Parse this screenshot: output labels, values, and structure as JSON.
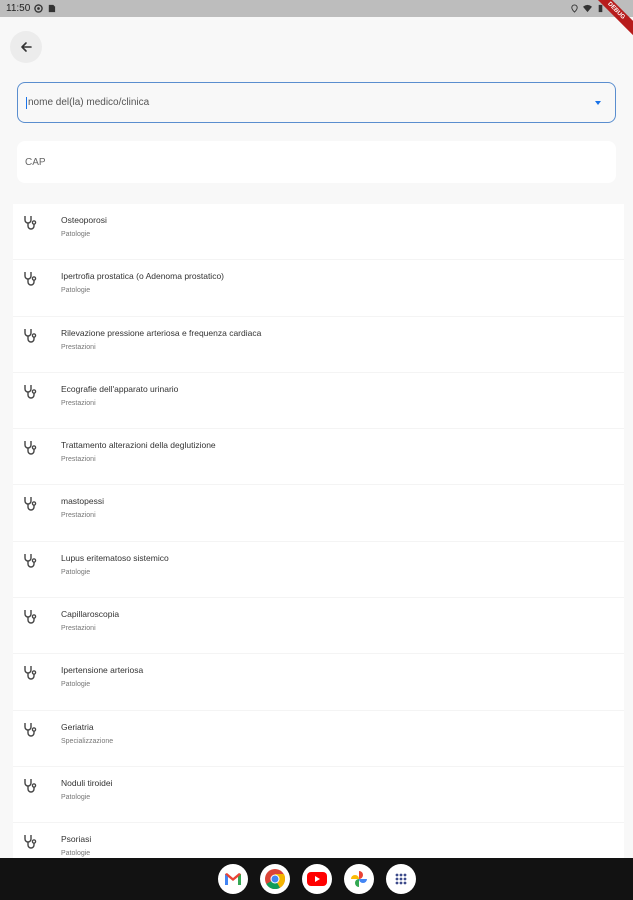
{
  "status_bar": {
    "time": "11:50"
  },
  "debug_banner": "DEBUG",
  "search": {
    "name_placeholder": "nome del(la) medico/clinica",
    "cap_placeholder": "CAP"
  },
  "results": [
    {
      "title": "Osteoporosi",
      "category": "Patologie"
    },
    {
      "title": "Ipertrofia prostatica (o Adenoma prostatico)",
      "category": "Patologie"
    },
    {
      "title": "Rilevazione pressione arteriosa e frequenza cardiaca",
      "category": "Prestazioni"
    },
    {
      "title": "Ecografie dell'apparato urinario",
      "category": "Prestazioni"
    },
    {
      "title": "Trattamento alterazioni della deglutizione",
      "category": "Prestazioni"
    },
    {
      "title": "mastopessi",
      "category": "Prestazioni"
    },
    {
      "title": "Lupus eritematoso sistemico",
      "category": "Patologie"
    },
    {
      "title": "Capillaroscopia",
      "category": "Prestazioni"
    },
    {
      "title": "Ipertensione arteriosa",
      "category": "Patologie"
    },
    {
      "title": "Geriatria",
      "category": "Specializzazione"
    },
    {
      "title": "Noduli tiroidei",
      "category": "Patologie"
    },
    {
      "title": "Psoriasi",
      "category": "Patologie"
    }
  ],
  "taskbar_apps": [
    "gmail-icon",
    "chrome-icon",
    "youtube-icon",
    "photos-icon",
    "app-drawer-icon"
  ],
  "colors": {
    "accent": "#1a73e8",
    "field_border": "#5a8ecf",
    "background": "#f8f8f8"
  }
}
